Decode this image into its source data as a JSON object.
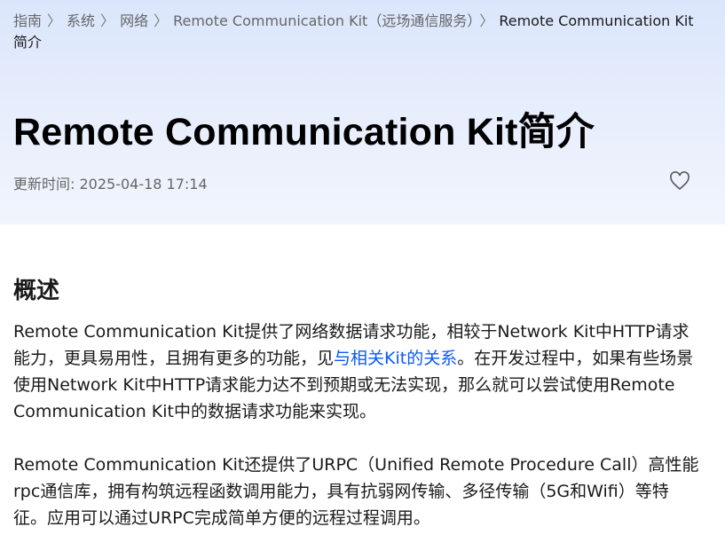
{
  "breadcrumb": {
    "items": [
      "指南",
      "系统",
      "网络",
      "Remote Communication Kit（远场通信服务）"
    ],
    "current": "Remote Communication Kit简介",
    "separator": "›"
  },
  "page": {
    "title": "Remote Communication Kit简介",
    "updated": "更新时间: 2025-04-18 17:14",
    "favorite_icon": "heart-outline-icon"
  },
  "section": {
    "heading": "概述",
    "p1_before": "Remote Communication Kit提供了网络数据请求功能，相较于Network Kit中HTTP请求能力，更具易用性，且拥有更多的功能，见",
    "p1_link": "与相关Kit的关系",
    "p1_after": "。在开发过程中，如果有些场景使用Network Kit中HTTP请求能力达不到预期或无法实现，那么就可以尝试使用Remote Communication Kit中的数据请求功能来实现。",
    "p2": "Remote Communication Kit还提供了URPC（Unified Remote Procedure Call）高性能rpc通信库，拥有构筑远程函数调用能力，具有抗弱网传输、多径传输（5G和Wifi）等特征。应用可以通过URPC完成简单方便的远程过程调用。"
  },
  "colors": {
    "link": "#0a59f7",
    "header_bg": "#dbe6fc"
  }
}
